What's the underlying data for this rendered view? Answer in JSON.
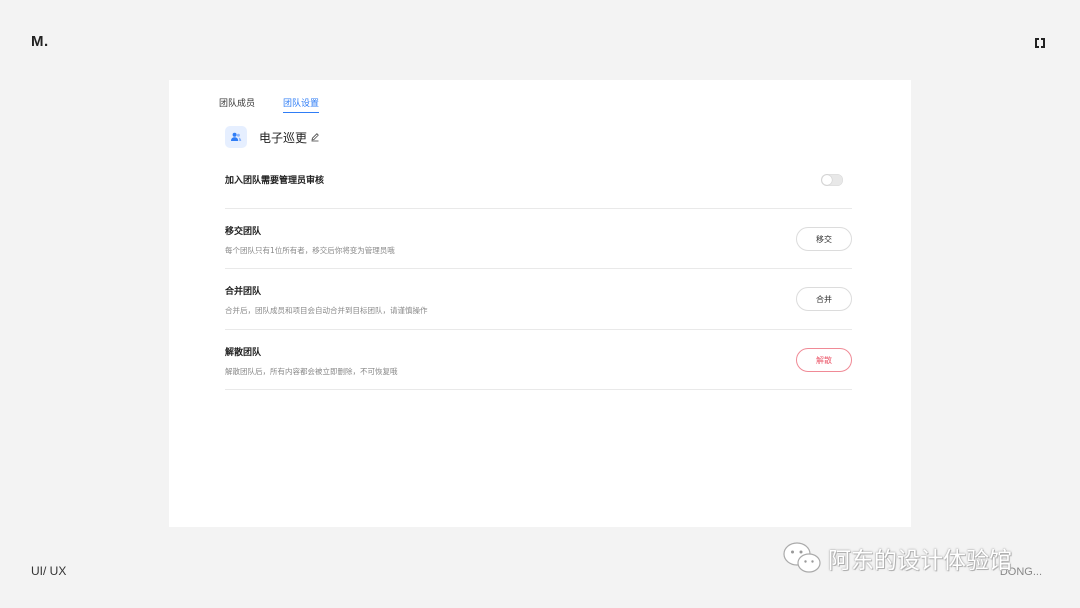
{
  "brand": {
    "logo": "M."
  },
  "footer": {
    "left": "UI/ UX"
  },
  "watermark": {
    "text": "阿东的设计体验馆",
    "behind_text": "DONG..."
  },
  "tabs": [
    {
      "label": "团队成员",
      "active": false
    },
    {
      "label": "团队设置",
      "active": true
    }
  ],
  "team": {
    "name": "电子巡更",
    "avatar_icon": "users-icon",
    "edit_icon": "pencil-icon"
  },
  "settings": {
    "approval": {
      "title": "加入团队需要管理员审核",
      "enabled": false
    },
    "transfer": {
      "title": "移交团队",
      "desc": "每个团队只有1位所有者，移交后你将变为管理员哦",
      "button": "移交"
    },
    "merge": {
      "title": "合并团队",
      "desc": "合并后，团队成员和项目会自动合并到目标团队，请谨慎操作",
      "button": "合并"
    },
    "dissolve": {
      "title": "解散团队",
      "desc": "解散团队后，所有内容都会被立即删除，不可恢复哦",
      "button": "解散"
    }
  },
  "colors": {
    "accent": "#2f7df6",
    "danger": "#ec5a6c",
    "background": "#f3f3f3",
    "panel": "#ffffff"
  }
}
